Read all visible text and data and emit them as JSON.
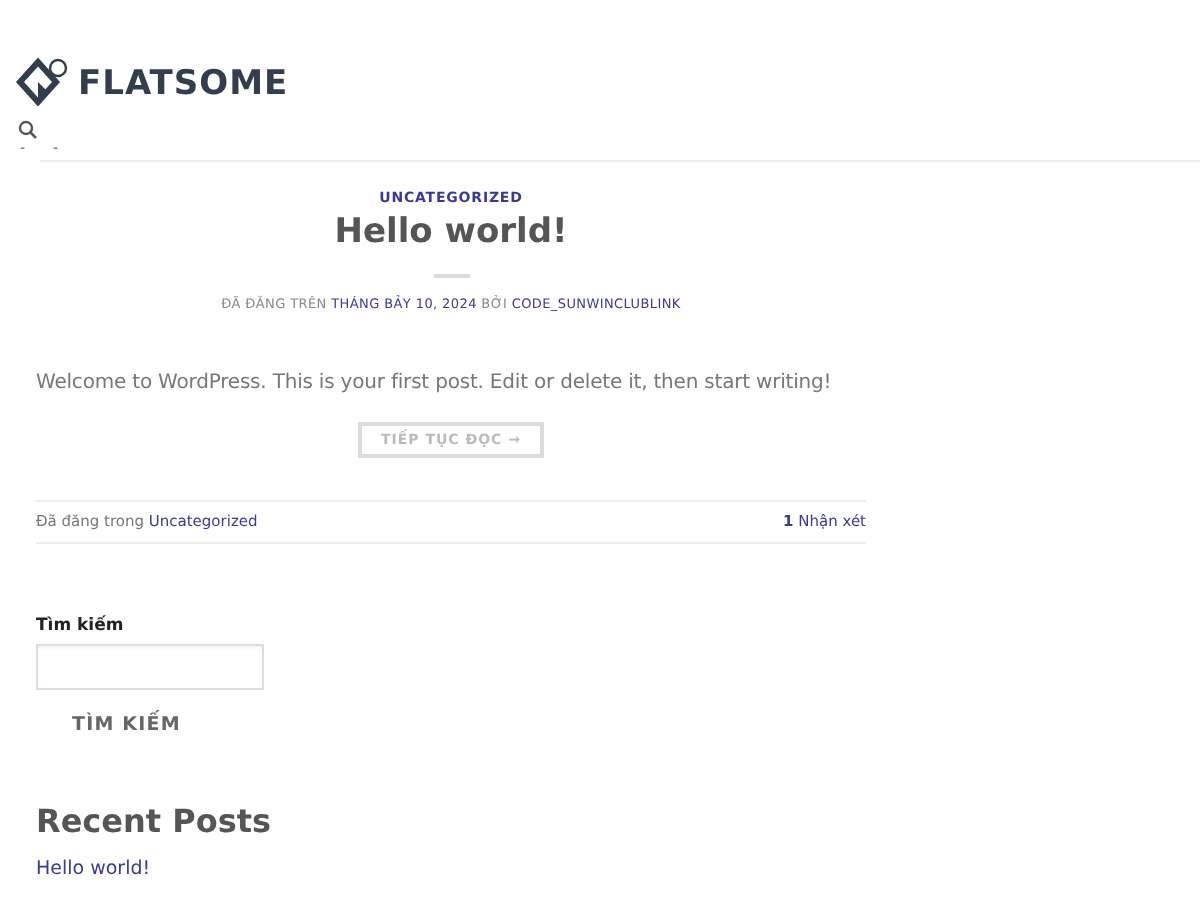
{
  "header": {
    "logo": "FLATSOME",
    "nav": [
      "-",
      "-"
    ]
  },
  "post": {
    "category": "UNCATEGORIZED",
    "title": "Hello world!",
    "meta_prefix": "ĐÃ ĐĂNG TRÊN",
    "date": "THÁNG BẢY 10, 2024",
    "meta_by": "BỞI",
    "author": "CODE_SUNWINCLUBLINK",
    "excerpt": "Welcome to WordPress. This is your first post. Edit or delete it, then start writing!",
    "more": "TIẾP TỤC ĐỌC →",
    "footer_prefix": "Đã đăng trong",
    "footer_category": "Uncategorized",
    "comment_count": "1",
    "comment_label": "Nhận xét"
  },
  "sidebar": {
    "search_label": "Tìm kiếm",
    "search_button": "TÌM KIẾM",
    "recent_title": "Recent Posts",
    "recent": [
      "Hello world!"
    ]
  }
}
